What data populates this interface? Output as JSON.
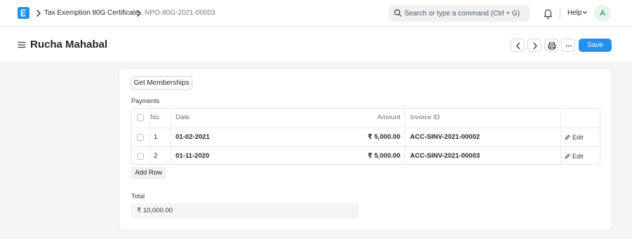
{
  "navbar": {
    "logo_letter": "E",
    "breadcrumbs": [
      "Tax Exemption 80G Certificate",
      "NPO-80G-2021-00003"
    ],
    "search_placeholder": "Search or type a command (Ctrl + G)",
    "help_label": "Help",
    "avatar_initial": "A"
  },
  "page": {
    "title": "Rucha Mahabal",
    "save_label": "Save"
  },
  "form": {
    "get_memberships_label": "Get Memberships",
    "payments_label": "Payments",
    "table": {
      "columns": [
        "No.",
        "Date",
        "Amount",
        "Invoice ID"
      ],
      "rows": [
        {
          "no": "1",
          "date": "01-02-2021",
          "amount": "₹ 5,000.00",
          "invoice": "ACC-SINV-2021-00002",
          "edit": "Edit"
        },
        {
          "no": "2",
          "date": "01-11-2020",
          "amount": "₹ 5,000.00",
          "invoice": "ACC-SINV-2021-00003",
          "edit": "Edit"
        }
      ]
    },
    "add_row_label": "Add Row",
    "total_label": "Total",
    "total_value": "₹ 10,000.00"
  },
  "colors": {
    "primary": "#2490ef",
    "background": "#f4f5f6",
    "avatar_bg": "#e4f5e9",
    "avatar_fg": "#16794c"
  },
  "icons": [
    "app-logo-icon",
    "chevron-right-icon",
    "search-icon",
    "bell-icon",
    "chevron-down-icon",
    "menu-icon",
    "chevron-left-icon",
    "printer-icon",
    "more-icon",
    "pencil-icon"
  ]
}
